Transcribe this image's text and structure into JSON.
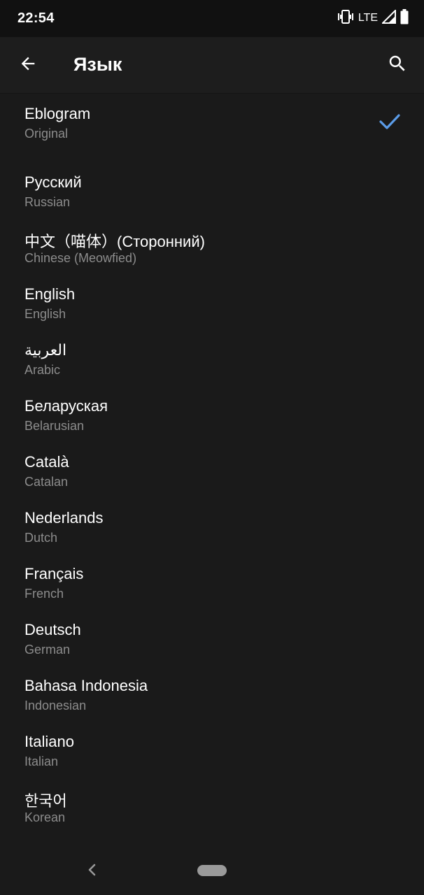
{
  "status_bar": {
    "time": "22:54",
    "network": "LTE",
    "icons": [
      "vibrate-icon",
      "signal-icon",
      "battery-icon"
    ]
  },
  "toolbar": {
    "title": "Язык",
    "back_icon": "arrow-back-icon",
    "search_icon": "search-icon"
  },
  "languages": [
    {
      "name": "Eblogram",
      "sub": "Original",
      "selected": true
    },
    {
      "name": "Русский",
      "sub": "Russian",
      "selected": false
    },
    {
      "name": "中文（喵体）(Сторонний)",
      "sub": "Chinese (Meowfied)",
      "selected": false
    },
    {
      "name": "English",
      "sub": "English",
      "selected": false
    },
    {
      "name": "العربية",
      "sub": "Arabic",
      "selected": false
    },
    {
      "name": "Беларуская",
      "sub": "Belarusian",
      "selected": false
    },
    {
      "name": "Català",
      "sub": "Catalan",
      "selected": false
    },
    {
      "name": "Nederlands",
      "sub": "Dutch",
      "selected": false
    },
    {
      "name": "Français",
      "sub": "French",
      "selected": false
    },
    {
      "name": "Deutsch",
      "sub": "German",
      "selected": false
    },
    {
      "name": "Bahasa Indonesia",
      "sub": "Indonesian",
      "selected": false
    },
    {
      "name": "Italiano",
      "sub": "Italian",
      "selected": false
    },
    {
      "name": "한국어",
      "sub": "Korean",
      "selected": false
    }
  ],
  "colors": {
    "background": "#1a1a1a",
    "accent_check": "#5b9ce8",
    "subtext": "#8c8c8c"
  },
  "nav_bar": {
    "back_icon": "nav-back-icon",
    "home_icon": "home-pill-icon"
  }
}
